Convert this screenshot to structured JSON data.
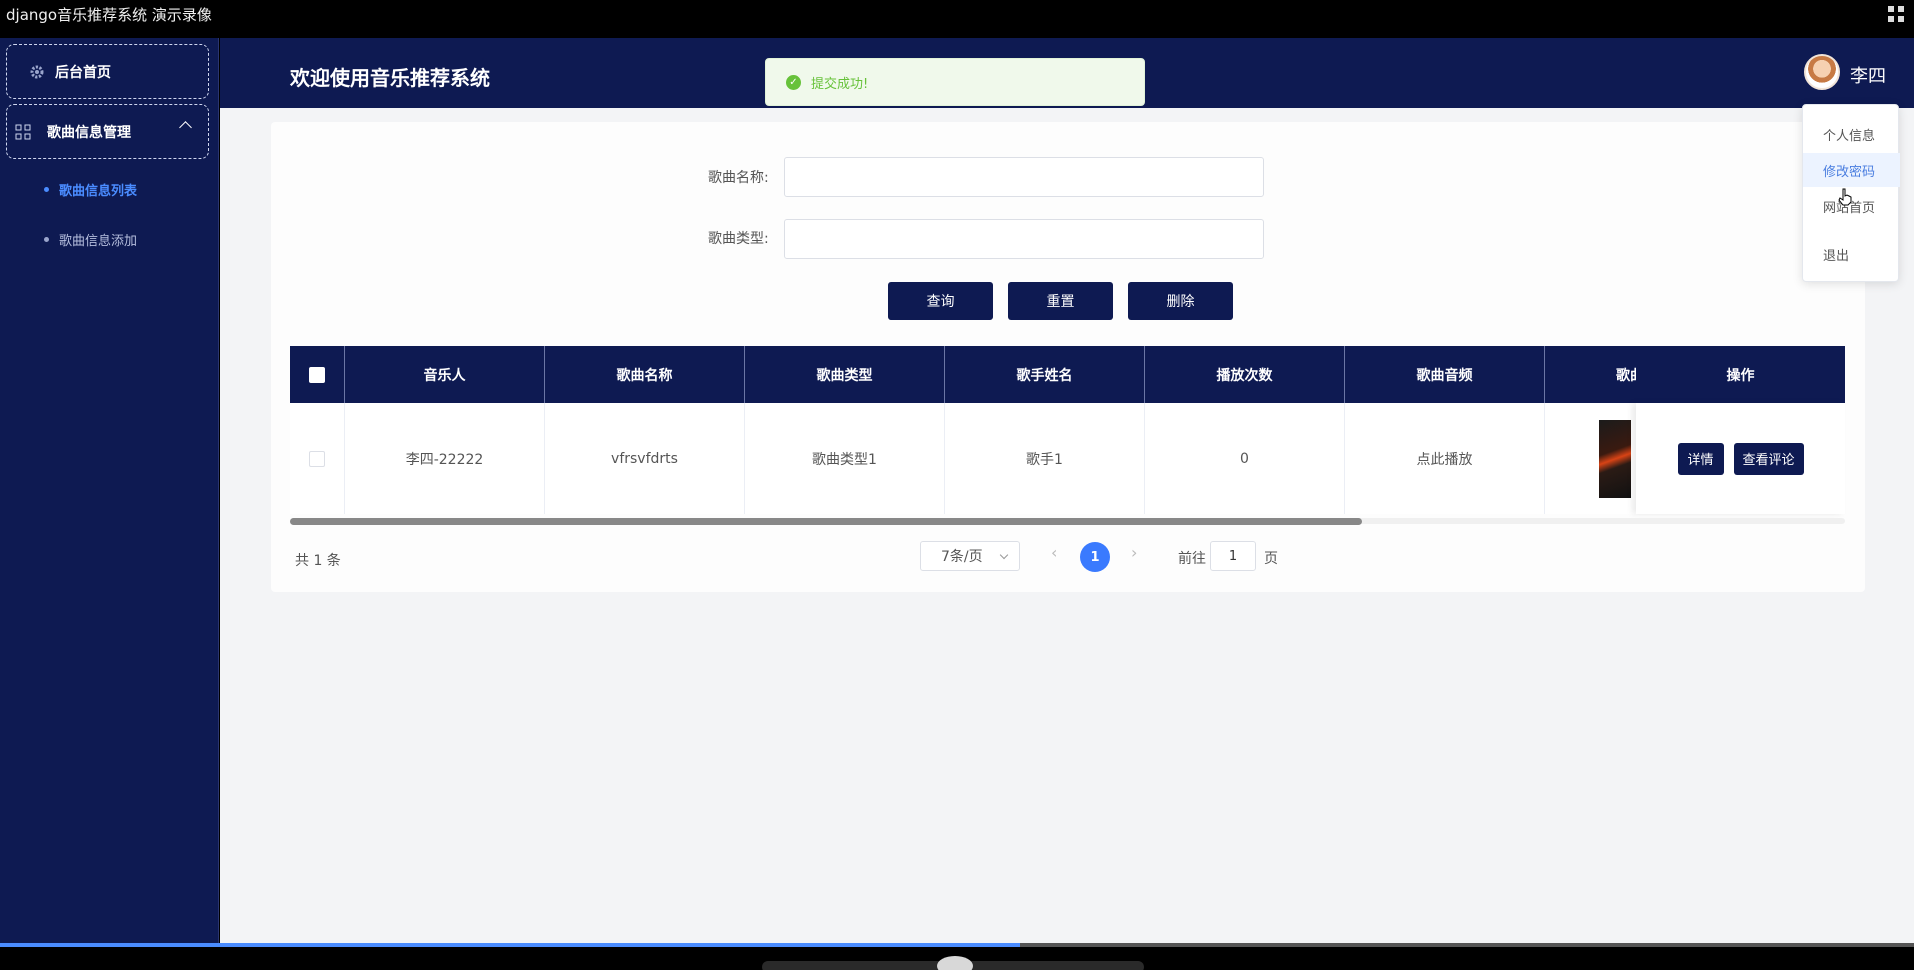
{
  "video": {
    "title": "django音乐推荐系统 演示录像"
  },
  "sidebar": {
    "home_label": "后台首页",
    "group_label": "歌曲信息管理",
    "items": [
      {
        "label": "歌曲信息列表",
        "active": true
      },
      {
        "label": "歌曲信息添加",
        "active": false
      }
    ]
  },
  "header": {
    "title": "欢迎使用音乐推荐系统",
    "username": "李四"
  },
  "toast": {
    "message": "提交成功!"
  },
  "search": {
    "name_label": "歌曲名称:",
    "name_value": "",
    "type_label": "歌曲类型:",
    "type_value": "",
    "query_label": "查询",
    "reset_label": "重置",
    "delete_label": "删除"
  },
  "table": {
    "columns": [
      "音乐人",
      "歌曲名称",
      "歌曲类型",
      "歌手姓名",
      "播放次数",
      "歌曲音频",
      "歌曲",
      "操作"
    ],
    "rows": [
      {
        "musician": "李四-22222",
        "song_name": "vfrsvfdrts",
        "song_type": "歌曲类型1",
        "singer": "歌手1",
        "play_count": "0",
        "audio": "点此播放",
        "detail_label": "详情",
        "comments_label": "查看评论"
      }
    ]
  },
  "pagination": {
    "total": "共 1 条",
    "page_size": "7条/页",
    "current_page": "1",
    "goto_prefix": "前往",
    "goto_value": "1",
    "goto_suffix": "页"
  },
  "user_menu": [
    {
      "label": "个人信息"
    },
    {
      "label": "修改密码"
    },
    {
      "label": "网站首页"
    },
    {
      "label": "退出"
    }
  ],
  "colors": {
    "primary": "#0e1a52",
    "accent": "#4a8cff",
    "success": "#67c23a"
  }
}
